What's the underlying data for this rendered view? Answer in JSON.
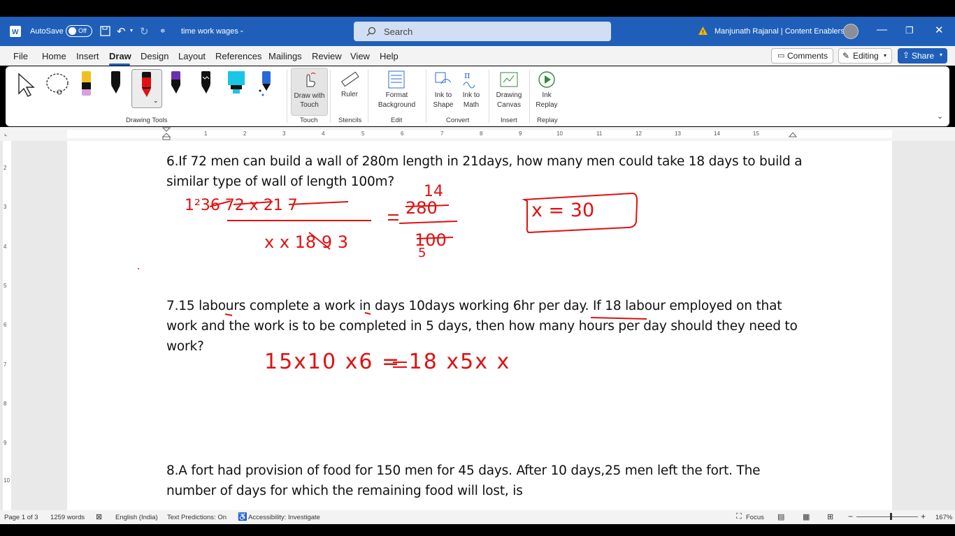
{
  "titlebar": {
    "autosave_label": "AutoSave",
    "autosave_state": "Off",
    "document_title": "time work wages",
    "search_placeholder": "Search",
    "user_name": "Manjunath Rajanal | Content Enablers"
  },
  "menu": [
    "File",
    "Home",
    "Insert",
    "Draw",
    "Design",
    "Layout",
    "References",
    "Mailings",
    "Review",
    "View",
    "Help"
  ],
  "menu_active": "Draw",
  "right_buttons": {
    "comments": "Comments",
    "editing": "Editing",
    "share": "Share"
  },
  "ribbon": {
    "tools": {
      "draw_with_touch": "Draw with Touch",
      "ruler": "Ruler",
      "format_background": "Format Background",
      "ink_to_shape": "Ink to Shape",
      "ink_to_math": "Ink to Math",
      "drawing_canvas": "Drawing Canvas",
      "ink_replay": "Ink Replay"
    },
    "groups": {
      "drawing_tools": "Drawing Tools",
      "touch": "Touch",
      "stencils": "Stencils",
      "edit": "Edit",
      "convert": "Convert",
      "insert": "Insert",
      "replay": "Replay"
    }
  },
  "ruler_numbers": [
    "1",
    "2",
    "3",
    "4",
    "5",
    "6",
    "7",
    "8",
    "9",
    "10",
    "11",
    "12",
    "13",
    "14",
    "15"
  ],
  "vruler_numbers": [
    "2",
    "3",
    "4",
    "5",
    "6",
    "7",
    "8",
    "9",
    "10"
  ],
  "document": {
    "q6_line1": "6.If 72 men can build a wall of 280m length in 21days, how many men could take 18 days to build a",
    "q6_line2": "similar type of wall of length 100m?",
    "q7_line1": "7.15 labours complete a work in days 10days working 6hr per day. If 18 labour employed on that",
    "q7_line2": "work and the work is to be completed in 5 days, then how many hours per day should they need to",
    "q7_line3": "work?",
    "q8_line1": "8.A fort had provision of food for 150 men for 45 days. After 10 days,25 men left the fort. The",
    "q8_line2": "number of days for which the remaining food will lost, is"
  },
  "ink": {
    "q6_top_numbers": "1²36  72 x 21 7",
    "q6_bottom": "x x 18 9 3",
    "q6_right_top": "14",
    "q6_right_num": "280",
    "q6_right_den": "100",
    "q6_right_den_alt": "5",
    "answer": "x = 30",
    "q7_equation": "15x10 x6 = 18 x5x x"
  },
  "status": {
    "page": "Page 1 of 3",
    "words": "1259 words",
    "language": "English (India)",
    "text_predictions": "Text Predictions: On",
    "accessibility": "Accessibility: Investigate",
    "focus": "Focus",
    "zoom": "167%"
  },
  "colors": {
    "accent": "#1f5fb9",
    "ink": "#e01010"
  }
}
